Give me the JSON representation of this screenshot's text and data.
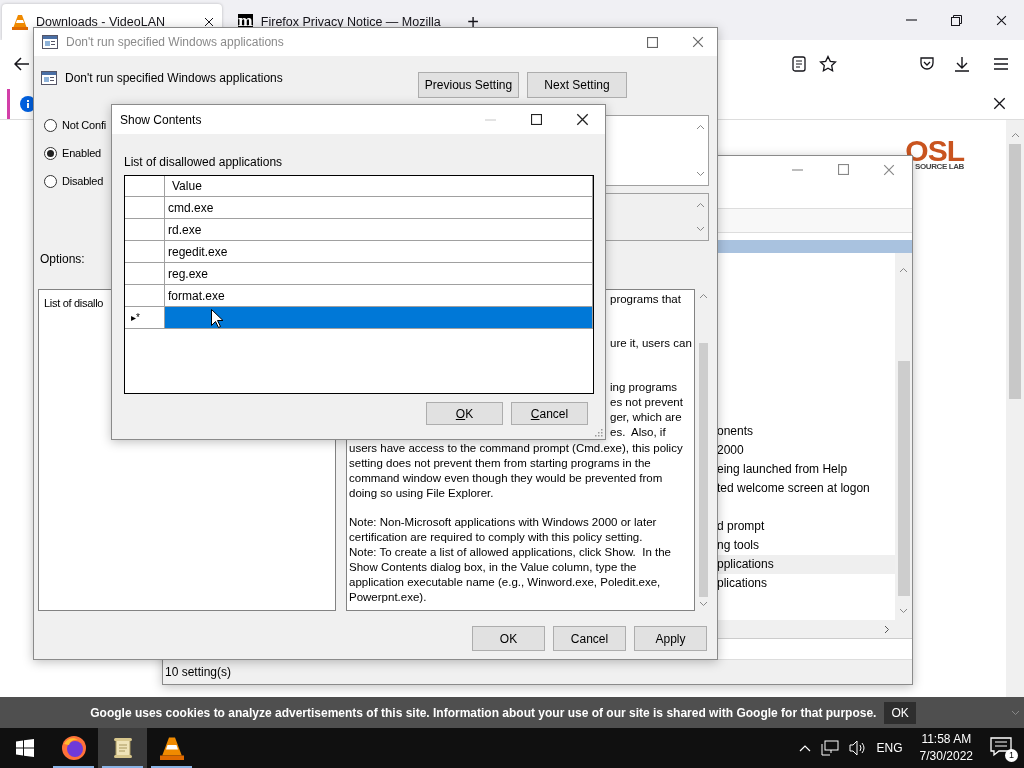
{
  "browser": {
    "tabs": [
      {
        "title": "Downloads - VideoLAN",
        "selected": true,
        "kind": "cone"
      },
      {
        "title": "Firefox Privacy Notice — Mozilla",
        "selected": false,
        "kind": "letter",
        "favicon_text": "m"
      }
    ],
    "new_tab": "+",
    "page": {
      "logo": {
        "mark": "OSL",
        "tagline": "SOURCE LAB"
      },
      "cookie_banner": {
        "text": "Google uses cookies to analyze advertisements of this site. Information about your use of our site is shared with Google for that purpose.",
        "button": "OK"
      }
    }
  },
  "policy_editor": {
    "item_groups": [
      [
        {
          "text": "onents",
          "selected": false
        },
        {
          "text": "2000",
          "selected": false
        },
        {
          "text": "eing launched from Help",
          "selected": false
        },
        {
          "text": "ted welcome screen at logon",
          "selected": false
        }
      ],
      [
        {
          "text": "d prompt",
          "selected": false
        },
        {
          "text": "ng tools",
          "selected": false
        },
        {
          "text": "pplications",
          "selected": true
        },
        {
          "text": "plications",
          "selected": false
        }
      ]
    ],
    "status": "10 setting(s)"
  },
  "policy_dialog": {
    "title": "Don't run specified Windows applications",
    "heading": "Don't run specified Windows applications",
    "nav_buttons": [
      "Previous Setting",
      "Next Setting"
    ],
    "options": [
      {
        "label": "Not Confi",
        "selected": false
      },
      {
        "label": "Enabled",
        "selected": true
      },
      {
        "label": "Disabled",
        "selected": false
      }
    ],
    "options_label": "Options:",
    "options_text": "List of disallo",
    "help_fragment_groups": [
      [
        "programs that"
      ],
      [
        "ure it, users can"
      ],
      [
        "ing programs",
        "es not prevent",
        "ger, which are",
        "es.  Also, if"
      ]
    ],
    "help_blocks": [
      [
        "users have access to the command prompt (Cmd.exe), this policy setting does not prevent them from starting programs in the command window even though they would be prevented from doing so using File Explorer."
      ],
      [
        "Note: Non-Microsoft applications with Windows 2000 or later certification are required to comply with this policy setting.",
        "Note: To create a list of allowed applications, click Show.  In the Show Contents dialog box, in the Value column, type the application executable name (e.g., Winword.exe, Poledit.exe, Powerpnt.exe)."
      ]
    ],
    "buttons": [
      "OK",
      "Cancel",
      "Apply"
    ]
  },
  "show_contents": {
    "title": "Show Contents",
    "label": "List of disallowed applications",
    "column": "Value",
    "rows": [
      {
        "value": "cmd.exe",
        "selected": false
      },
      {
        "value": "rd.exe",
        "selected": false
      },
      {
        "value": "regedit.exe",
        "selected": false
      },
      {
        "value": "reg.exe",
        "selected": false
      },
      {
        "value": "format.exe",
        "selected": false
      },
      {
        "marker": "▸*",
        "selected": true
      }
    ],
    "buttons": [
      "OK",
      "Cancel"
    ]
  },
  "taskbar": {
    "apps": [
      {
        "kind": "firefox",
        "active": false
      },
      {
        "kind": "notes",
        "active": true
      },
      {
        "kind": "cone",
        "active": false
      }
    ],
    "language": "ENG",
    "time": "11:58 AM",
    "date": "7/30/2022",
    "notifications": "1"
  }
}
